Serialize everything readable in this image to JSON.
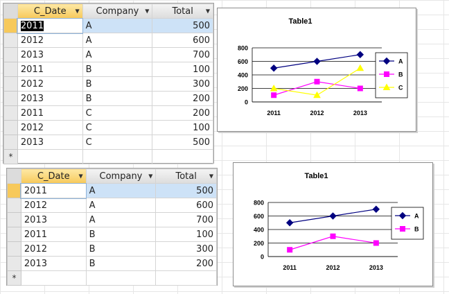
{
  "top_table": {
    "columns": [
      "C_Date",
      "Company",
      "Total"
    ],
    "rows": [
      [
        "2011",
        "A",
        "500"
      ],
      [
        "2012",
        "A",
        "600"
      ],
      [
        "2013",
        "A",
        "700"
      ],
      [
        "2011",
        "B",
        "100"
      ],
      [
        "2012",
        "B",
        "300"
      ],
      [
        "2013",
        "B",
        "200"
      ],
      [
        "2011",
        "C",
        "200"
      ],
      [
        "2012",
        "C",
        "100"
      ],
      [
        "2013",
        "C",
        "500"
      ]
    ],
    "new_row_marker": "*"
  },
  "bottom_table": {
    "columns": [
      "C_Date",
      "Company",
      "Total"
    ],
    "rows": [
      [
        "2011",
        "A",
        "500"
      ],
      [
        "2012",
        "A",
        "600"
      ],
      [
        "2013",
        "A",
        "700"
      ],
      [
        "2011",
        "B",
        "100"
      ],
      [
        "2012",
        "B",
        "300"
      ],
      [
        "2013",
        "B",
        "200"
      ]
    ],
    "new_row_marker": "*"
  },
  "chart_data": [
    {
      "type": "line",
      "title": "Table1",
      "categories": [
        "2011",
        "2012",
        "2013"
      ],
      "ylim": [
        0,
        800
      ],
      "yticks": [
        0,
        200,
        400,
        600,
        800
      ],
      "grid": true,
      "legend": "right",
      "series": [
        {
          "name": "A",
          "values": [
            500,
            600,
            700
          ],
          "color": "#000080",
          "marker": "diamond"
        },
        {
          "name": "B",
          "values": [
            100,
            300,
            200
          ],
          "color": "#ff00ff",
          "marker": "square"
        },
        {
          "name": "C",
          "values": [
            200,
            100,
            500
          ],
          "color": "#ffff00",
          "marker": "triangle"
        }
      ]
    },
    {
      "type": "line",
      "title": "Table1",
      "categories": [
        "2011",
        "2012",
        "2013"
      ],
      "ylim": [
        0,
        800
      ],
      "yticks": [
        0,
        200,
        400,
        600,
        800
      ],
      "grid": true,
      "legend": "right",
      "series": [
        {
          "name": "A",
          "values": [
            500,
            600,
            700
          ],
          "color": "#000080",
          "marker": "diamond"
        },
        {
          "name": "B",
          "values": [
            100,
            300,
            200
          ],
          "color": "#ff00ff",
          "marker": "square"
        }
      ]
    }
  ]
}
